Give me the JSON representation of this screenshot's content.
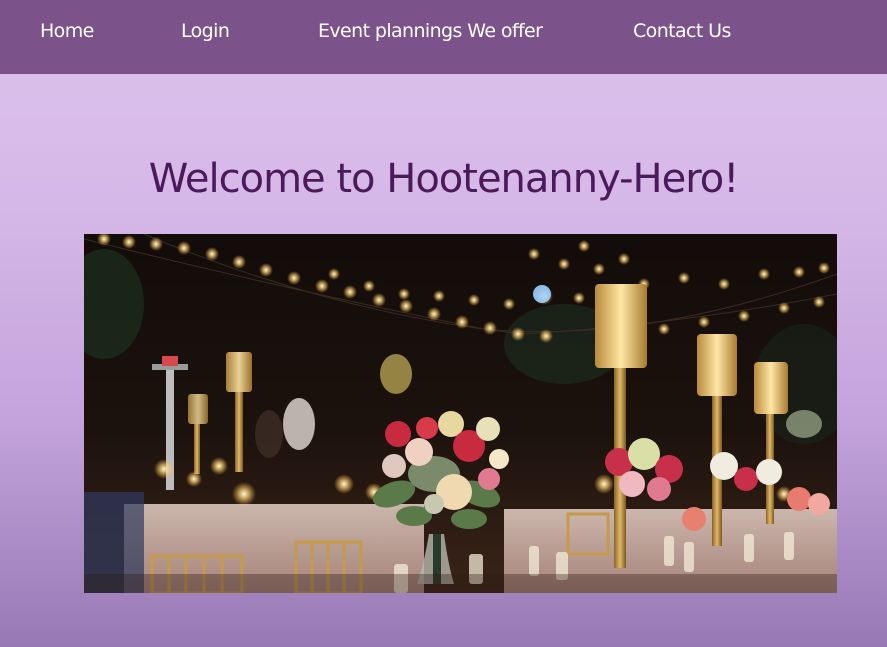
{
  "nav": {
    "items": [
      {
        "label": "Home"
      },
      {
        "label": "Login"
      },
      {
        "label": "Event plannings We offer"
      },
      {
        "label": "Contact Us"
      }
    ]
  },
  "main": {
    "heading": "Welcome to Hootenanny-Hero!"
  },
  "colors": {
    "navbar": "#7b5289",
    "heading": "#4a1a5a",
    "page_top": "#ddc3ec",
    "page_bottom": "#9878b4"
  }
}
